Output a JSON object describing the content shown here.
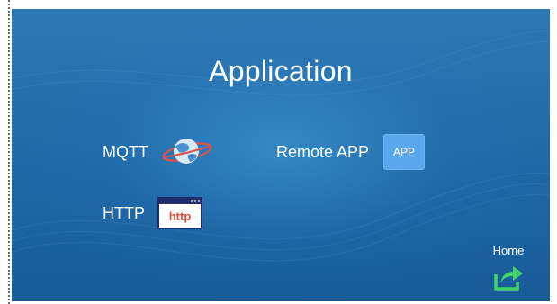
{
  "screen": {
    "title": "Application"
  },
  "items": {
    "mqtt": {
      "label": "MQTT",
      "icon": "planet-icon"
    },
    "http": {
      "label": "HTTP",
      "icon": "http-browser-icon",
      "icon_text": "http"
    },
    "remote_app": {
      "label": "Remote APP",
      "icon": "app-icon",
      "icon_text": "APP"
    }
  },
  "home": {
    "label": "Home",
    "icon": "share-arrow-icon"
  },
  "colors": {
    "background": "#1f68a6",
    "app_icon": "#5aa7ec",
    "home_icon": "#44d46a",
    "http_text": "#e8473a"
  }
}
